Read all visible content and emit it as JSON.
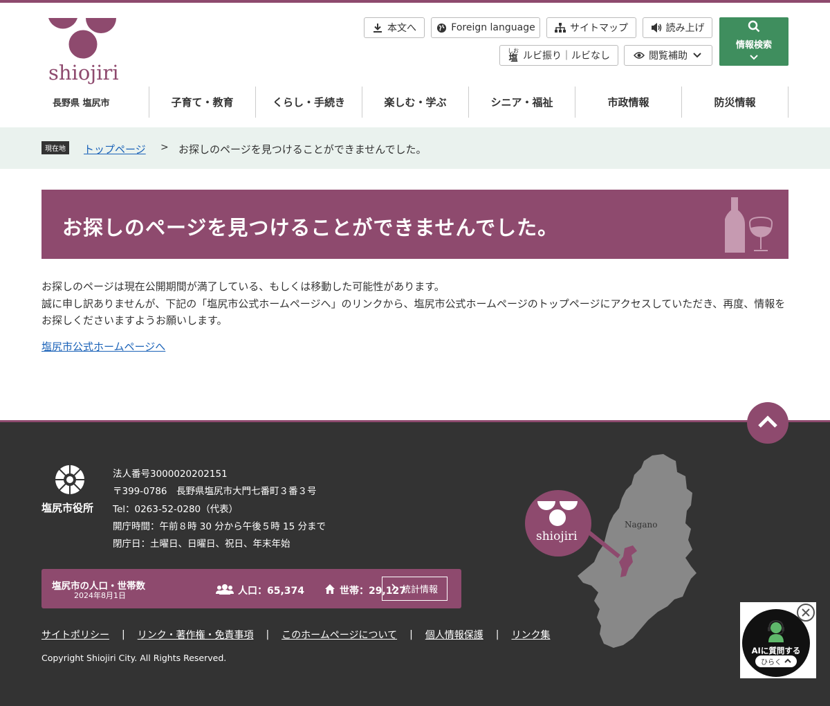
{
  "header": {
    "logo_text": "shiojiri",
    "prefecture": "長野県 塩尻市",
    "tools": {
      "skip": "本文へ",
      "foreign": "Foreign language",
      "sitemap": "サイトマップ",
      "readaloud": "読み上げ",
      "ruby": "ルビ振り｜ルビなし",
      "ruby_icon_top": "しお",
      "ruby_icon_bottom": "塩",
      "assist": "閲覧補助",
      "search": "情報検索"
    },
    "nav": [
      "子育て・教育",
      "くらし・手続き",
      "楽しむ・学ぶ",
      "シニア・福祉",
      "市政情報",
      "防災情報"
    ]
  },
  "breadcrumb": {
    "tag": "現在地",
    "home": "トップページ",
    "separator": ">",
    "current": "お探しのページを見つけることができませんでした。"
  },
  "main": {
    "title": "お探しのページを見つけることができませんでした。",
    "line1": "お探しのページは現在公開期間が満了している、もしくは移動した可能性があります。",
    "line2": "誠に申し訳ありませんが、下記の「塩尻市公式ホームページへ」のリンクから、塩尻市公式ホームページのトップページにアクセスしていただき、再度、情報をお探しくださいますようお願いします。",
    "home_link": "塩尻市公式ホームページへ"
  },
  "footer": {
    "city_hall": "塩尻市役所",
    "info": [
      "法人番号3000020202151",
      "〒399-0786　長野県塩尻市大門七番町３番３号",
      "Tel：0263-52-0280（代表）",
      "開庁時間：午前８時 30 分から午後５時 15 分まで",
      "閉庁日：土曜日、日曜日、祝日、年末年始"
    ],
    "stats": {
      "title": "塩尻市の人口・世帯数",
      "date": "2024年8月1日",
      "population": "人口：65,374",
      "households": "世帯：29,127",
      "button": "統計情報"
    },
    "links": [
      "サイトポリシー",
      "リンク・著作権・免責事項",
      "このホームページについて",
      "個人情報保護",
      "リンク集"
    ],
    "copyright": "Copyright Shiojiri City. All Rights Reserved.",
    "map_label": "Nagano",
    "map_logo": "shiojiri"
  },
  "ai_widget": {
    "label": "AIに質問する",
    "open": "ひらく"
  },
  "colors": {
    "brand": "#8e4a6e",
    "search": "#3f8e5e",
    "footer_bg": "#333333",
    "crumb_bg": "#eaf2ee"
  }
}
